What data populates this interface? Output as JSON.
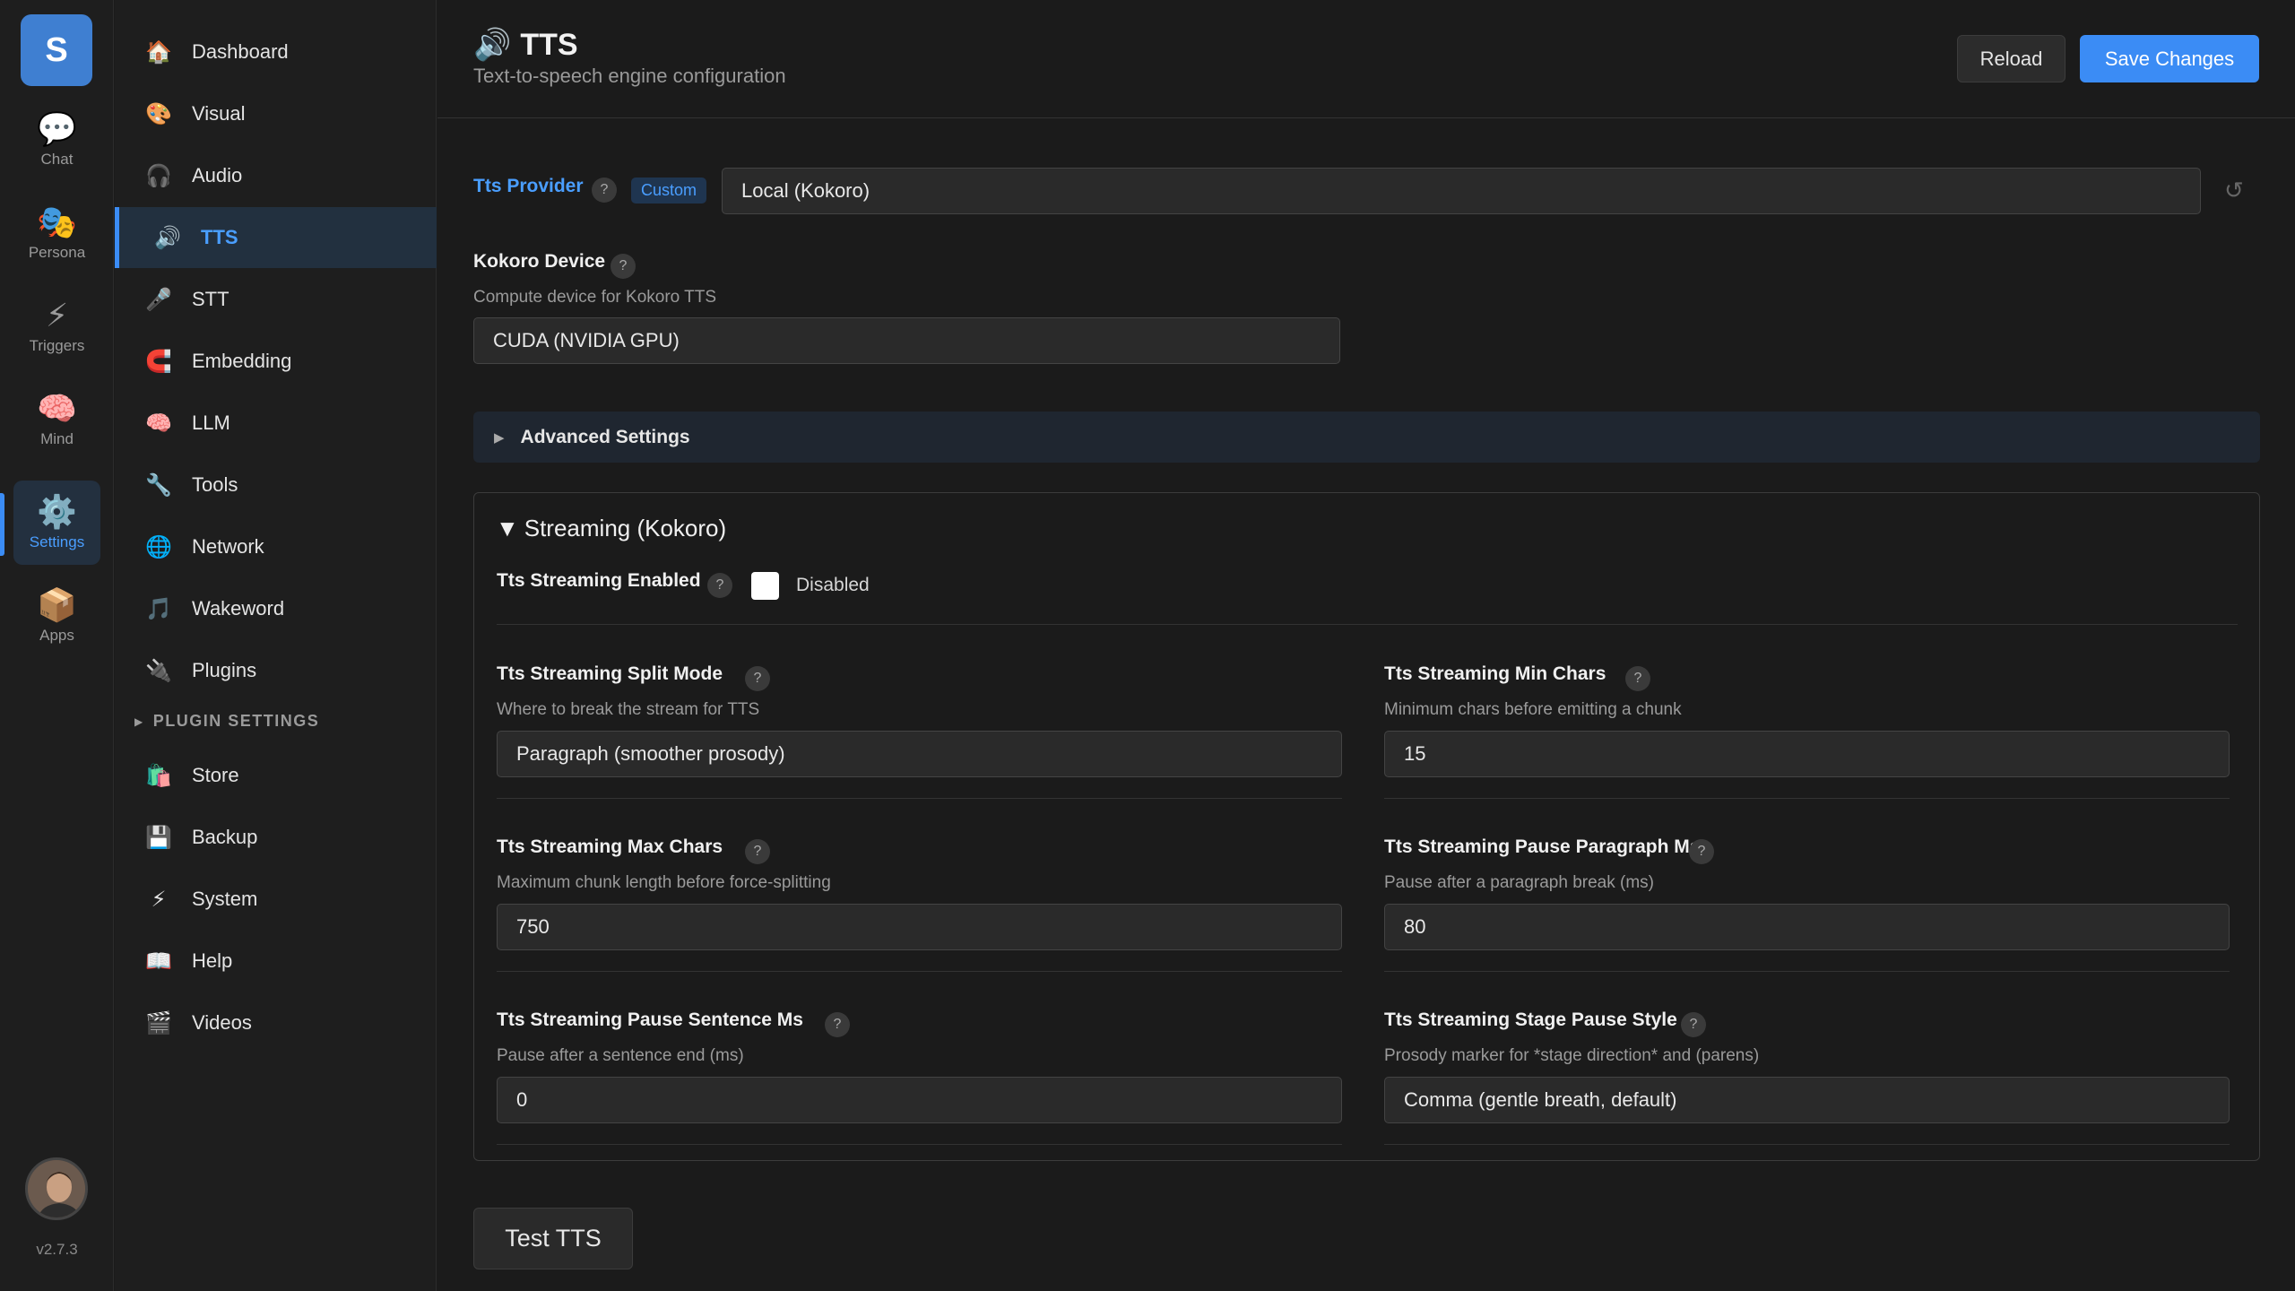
{
  "rail": {
    "logo": "S",
    "items": [
      {
        "label": "Chat",
        "icon": "💬"
      },
      {
        "label": "Persona",
        "icon": "🎭"
      },
      {
        "label": "Triggers",
        "icon": "⚡"
      },
      {
        "label": "Mind",
        "icon": "🧠"
      },
      {
        "label": "Settings",
        "icon": "⚙️"
      },
      {
        "label": "Apps",
        "icon": "📦"
      }
    ],
    "active": "Settings",
    "version": "v2.7.3"
  },
  "sidebar": {
    "items": [
      {
        "label": "Dashboard",
        "icon": "🏠"
      },
      {
        "label": "Visual",
        "icon": "🎨"
      },
      {
        "label": "Audio",
        "icon": "🎧"
      },
      {
        "label": "TTS",
        "icon": "🔊"
      },
      {
        "label": "STT",
        "icon": "🎤"
      },
      {
        "label": "Embedding",
        "icon": "🧲"
      },
      {
        "label": "LLM",
        "icon": "🧠"
      },
      {
        "label": "Tools",
        "icon": "🔧"
      },
      {
        "label": "Network",
        "icon": "🌐"
      },
      {
        "label": "Wakeword",
        "icon": "🎵"
      },
      {
        "label": "Plugins",
        "icon": "🔌"
      }
    ],
    "section_label": "PLUGIN SETTINGS",
    "plugin_items": [
      {
        "label": "Store",
        "icon": "🛍️"
      },
      {
        "label": "Backup",
        "icon": "💾"
      },
      {
        "label": "System",
        "icon": "⚡"
      },
      {
        "label": "Help",
        "icon": "📖"
      },
      {
        "label": "Videos",
        "icon": "🎬"
      }
    ],
    "active": "TTS"
  },
  "header": {
    "icon": "🔊",
    "title": "TTS",
    "subtitle": "Text-to-speech engine configuration",
    "reload_label": "Reload",
    "save_label": "Save Changes"
  },
  "provider": {
    "label": "Tts Provider",
    "badge": "Custom",
    "value": "Local (Kokoro)",
    "help": "?"
  },
  "device": {
    "label": "Kokoro Device",
    "description": "Compute device for Kokoro TTS",
    "value": "CUDA (NVIDIA GPU)"
  },
  "advanced": {
    "label": "Advanced Settings"
  },
  "streaming": {
    "title": "Streaming (Kokoro)",
    "enabled_label": "Tts Streaming Enabled",
    "enabled_state": "Disabled",
    "fields": [
      {
        "label": "Tts Streaming Split Mode",
        "description": "Where to break the stream for TTS",
        "value": "Paragraph (smoother prosody)"
      },
      {
        "label": "Tts Streaming Min Chars",
        "description": "Minimum chars before emitting a chunk",
        "value": "15"
      },
      {
        "label": "Tts Streaming Max Chars",
        "description": "Maximum chunk length before force-splitting",
        "value": "750"
      },
      {
        "label": "Tts Streaming Pause Paragraph Ms",
        "description": "Pause after a paragraph break (ms)",
        "value": "80"
      },
      {
        "label": "Tts Streaming Pause Sentence Ms",
        "description": "Pause after a sentence end (ms)",
        "value": "0"
      },
      {
        "label": "Tts Streaming Stage Pause Style",
        "description": "Prosody marker for *stage direction* and (parens)",
        "value": "Comma (gentle breath, default)"
      }
    ]
  },
  "test_button": "Test TTS",
  "colors": {
    "accent": "#3b8cf5",
    "background": "#1b1b1b",
    "panel": "#1e1e1e"
  }
}
